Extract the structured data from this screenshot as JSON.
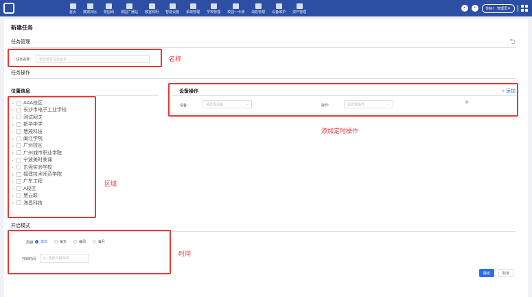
{
  "nav": {
    "items": [
      "首页",
      "数据对比",
      "校园网",
      "校园广播站",
      "教室照明",
      "智能设施",
      "系统管理",
      "学校管理",
      "校园一卡通",
      "消息管理",
      "设备维护",
      "资产管理"
    ]
  },
  "user": {
    "name": "你好！ 管理员▼"
  },
  "page": {
    "title": "新建任务",
    "section_task": "任务管理",
    "section_op": "任务操作",
    "section_mode": "开启模式",
    "back_icon": "undo-icon"
  },
  "form": {
    "name_label": "任务名称:",
    "name_placeholder": "请您填写任务名字",
    "location_title": "位置信息",
    "device_title": "设备操作",
    "add_label": "+ 添加",
    "device_label": "设备:",
    "device_placeholder": "请选择设备",
    "op_label": "操作:",
    "op_placeholder": "请选择操作",
    "cycle_label": "周期:",
    "cycle_options": [
      "单次",
      "每天",
      "每周",
      "每月"
    ],
    "cycle_selected": "单次",
    "start_label": "开启时间:",
    "start_placeholder": "选择日期时间"
  },
  "tree": [
    "AAA校区",
    "长沙市电子工业学校",
    "测试网关",
    "新华中学",
    "慧茂科技",
    "闽江学院",
    "广州校区",
    "广州城市职业学院",
    "宁波美时美课",
    "东莞实验学校",
    "福建技术师范学院",
    "广东工程",
    "A校区",
    "慧云联",
    "海昌科技"
  ],
  "annotations": {
    "name": "名称",
    "timed_op": "添加定时操作",
    "area": "区域",
    "time": "时间"
  },
  "buttons": {
    "confirm": "确定",
    "cancel": "取消"
  },
  "colors": {
    "nav_bg": "#2d4fa3",
    "primary": "#2d6ef0",
    "annotation": "#e53935"
  }
}
